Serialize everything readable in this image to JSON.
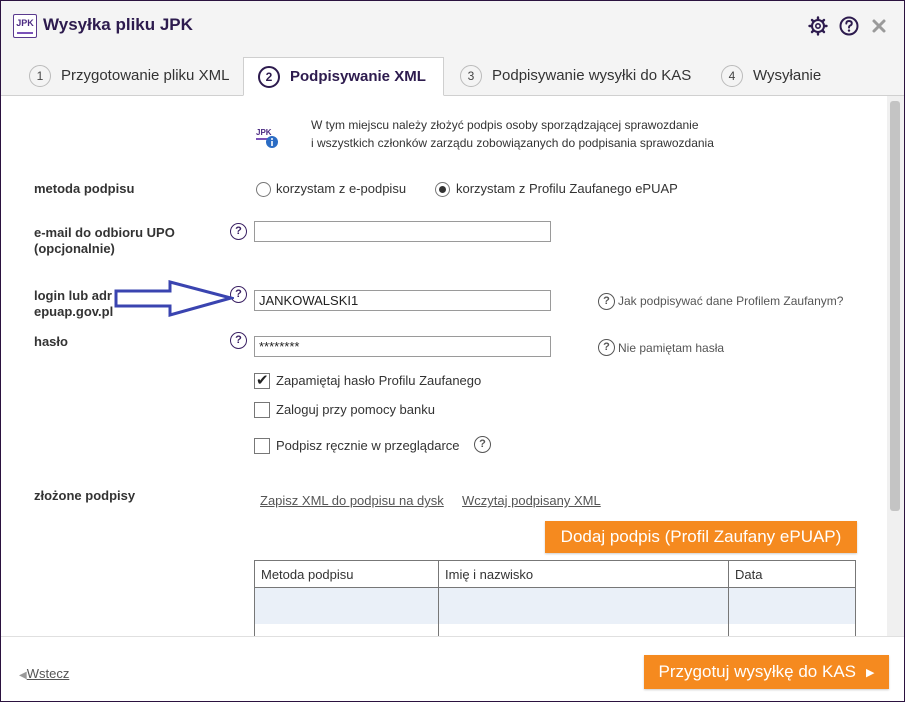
{
  "window": {
    "title": "Wysyłka pliku JPK",
    "logo_text": "JPK"
  },
  "tabs": [
    {
      "num": "1",
      "label": "Przygotowanie pliku XML"
    },
    {
      "num": "2",
      "label": "Podpisywanie XML"
    },
    {
      "num": "3",
      "label": "Podpisywanie wysyłki do KAS"
    },
    {
      "num": "4",
      "label": "Wysyłanie"
    }
  ],
  "info": {
    "line1": "W tym miejscu należy złożyć podpis osoby sporządzającej sprawozdanie",
    "line2": "i wszystkich członków zarządu zobowiązanych do podpisania sprawozdania"
  },
  "form": {
    "method_label": "metoda podpisu",
    "method_opt1": "korzystam z e-podpisu",
    "method_opt2": "korzystam z Profilu Zaufanego ePUAP",
    "email_label_1": "e-mail do odbioru UPO",
    "email_label_2": "(opcjonalnie)",
    "email_value": "",
    "login_label_1": "login lub adr",
    "login_label_2": "epuap.gov.pl",
    "login_value": "JANKOWALSKI1",
    "login_help": "Jak podpisywać dane Profilem Zaufanym?",
    "password_label": "hasło",
    "password_value": "********",
    "password_help": "Nie pamiętam hasła",
    "remember_label": "Zapamiętaj hasło Profilu Zaufanego",
    "bank_label": "Zaloguj przy pomocy banku",
    "manual_label": "Podpisz ręcznie w przeglądarce",
    "help_char": "?"
  },
  "signatures": {
    "label": "złożone podpisy",
    "save_link": "Zapisz XML do podpisu na dysk",
    "load_link": "Wczytaj podpisany XML",
    "add_button": "Dodaj podpis (Profil Zaufany ePUAP)",
    "columns": [
      "Metoda podpisu",
      "Imię i nazwisko",
      "Data"
    ]
  },
  "footer": {
    "back": "Wstecz",
    "back_arrow": "◀",
    "next": "Przygotuj wysyłkę do KAS",
    "next_arrow": "▶"
  },
  "colors": {
    "accent": "#f58a1f",
    "brand": "#2d1b4e",
    "arrow": "#3a44b0"
  }
}
